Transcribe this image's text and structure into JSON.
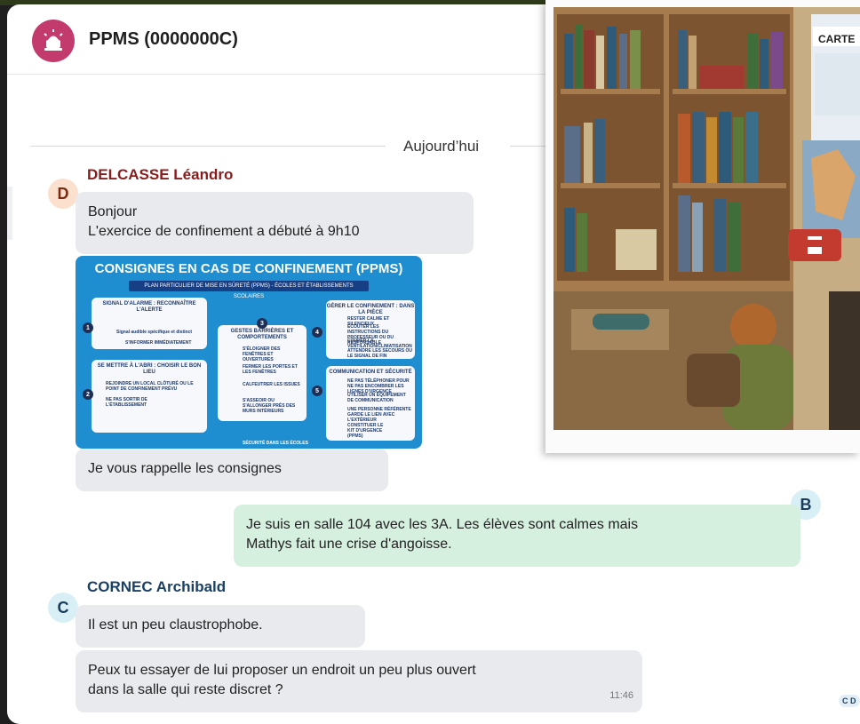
{
  "header": {
    "title": "PPMS (0000000C)",
    "icon": "siren-icon",
    "icon_color": "#c23b6c"
  },
  "day_separator": "Aujourd’hui",
  "messages": [
    {
      "sender": "DELCASSE Léandro",
      "avatar": "D",
      "lines": [
        "Bonjour",
        "L'exercice de confinement a débuté à 9h10"
      ]
    },
    {
      "sender": "DELCASSE Léandro",
      "type": "image",
      "image": {
        "title": "CONSIGNES EN CAS DE CONFINEMENT (PPMS)",
        "subtitle": "PLAN PARTICULIER DE MISE EN SÛRETÉ (PPMS) - ÉCOLES ET ÉTABLISSEMENTS SCOLAIRES",
        "sections": [
          {
            "number": "1",
            "title": "SIGNAL D'ALARME : RECONNAÎTRE L'ALERTE",
            "items": [
              "Signal audible spécifique et distinct",
              "S'INFORMER IMMÉDIATEMENT"
            ]
          },
          {
            "number": "2",
            "title": "SE METTRE À L'ABRI : CHOISIR LE BON LIEU",
            "items": [
              "REJOINDRE UN LOCAL CLÔTURÉ OU LE POINT DE CONFINEMENT PRÉVU",
              "NE PAS SORTIR DE L'ÉTABLISSEMENT"
            ]
          },
          {
            "number": "3",
            "title": "GESTES BARRIÈRES ET COMPORTEMENTS",
            "items": [
              "S'ÉLOIGNER DES FENÊTRES ET OUVERTURES",
              "FERMER LES PORTES ET LES FENÊTRES",
              "CALFEUTRER LES ISSUES",
              "S'ASSEOIR OU S'ALLONGER PRÈS DES MURS INTÉRIEURS"
            ]
          },
          {
            "number": "4",
            "title": "GÉRER LE CONFINEMENT : DANS LA PIÈCE",
            "items": [
              "RESTER CALME ET SILENCIEUX",
              "ÉCOUTER LES INSTRUCTIONS DU PROFESSEUR OU DU RESPONSABLE",
              "COUPER LA VENTILATION/CLIMATISATION",
              "ATTENDRE LES SECOURS OU LE SIGNAL DE FIN"
            ]
          },
          {
            "number": "5",
            "title": "COMMUNICATION ET SÉCURITÉ",
            "items": [
              "NE PAS TÉLÉPHONER POUR NE PAS ENCOMBRER LES LIGNES D'URGENCE",
              "UTILISER UN ÉQUIPEMENT DE COMMUNICATION",
              "UNE PERSONNE RÉFÉRENTE GARDE LE LIEN AVEC L'EXTÉRIEUR",
              "CONSTITUER LE KIT D'URGENCE (PPMS)"
            ]
          }
        ],
        "footer": "SÉCURITÉ DANS LES ÉCOLES"
      }
    },
    {
      "sender": "DELCASSE Léandro",
      "lines": [
        "Je vous rappelle les consignes"
      ]
    },
    {
      "sender": "B",
      "avatar": "B",
      "own": true,
      "lines": [
        "Je suis en salle 104 avec les 3A. Les élèves sont calmes mais",
        "Mathys fait une crise d'angoisse."
      ]
    },
    {
      "sender": "CORNEC Archibald",
      "avatar": "C",
      "lines": [
        "Il est un peu claustrophobe."
      ]
    },
    {
      "sender": "CORNEC Archibald",
      "lines": [
        "Peux tu essayer de lui proposer un endroit un peu plus ouvert",
        "dans la salle qui reste discret ?"
      ],
      "time": "11:46"
    }
  ],
  "photo": {
    "map_label": "CARTE",
    "description_icon": "classroom-photo"
  },
  "corner_badge": "C D",
  "colors": {
    "own_bubble": "#d6f0e0",
    "other_bubble": "#e8eaee",
    "sender_d": "#8b1c1c",
    "sender_c": "#1b4066"
  }
}
